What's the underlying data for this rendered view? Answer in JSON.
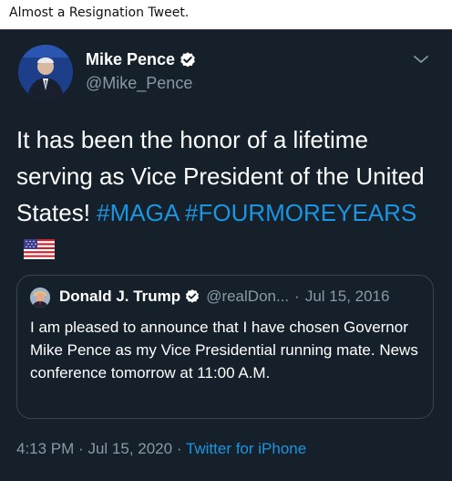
{
  "caption": "Almost a Resignation Tweet.",
  "tweet": {
    "author_name": "Mike Pence",
    "author_handle": "@Mike_Pence",
    "text_main": "It has been the honor of a lifetime serving as Vice President of the United States!",
    "hashtag1": "#MAGA",
    "hashtag2": "#FOURMOREYEARS",
    "time": "4:13 PM",
    "date": "Jul 15, 2020",
    "source": "Twitter for iPhone",
    "dot": "·"
  },
  "quoted": {
    "author_name": "Donald J. Trump",
    "author_handle": "@realDon...",
    "date": "Jul 15, 2016",
    "text": "I am pleased to announce that I have chosen Governor Mike Pence as my Vice Presidential running mate. News conference tomorrow at 11:00 A.M."
  },
  "colors": {
    "background": "#15202b",
    "text": "#ffffff",
    "secondary": "#8899a6",
    "link": "#1b95e0",
    "verified": "#ffffff"
  },
  "icons": {
    "verified": "verified-badge-icon",
    "chevron": "chevron-down-icon",
    "flag": "us-flag-emoji"
  }
}
